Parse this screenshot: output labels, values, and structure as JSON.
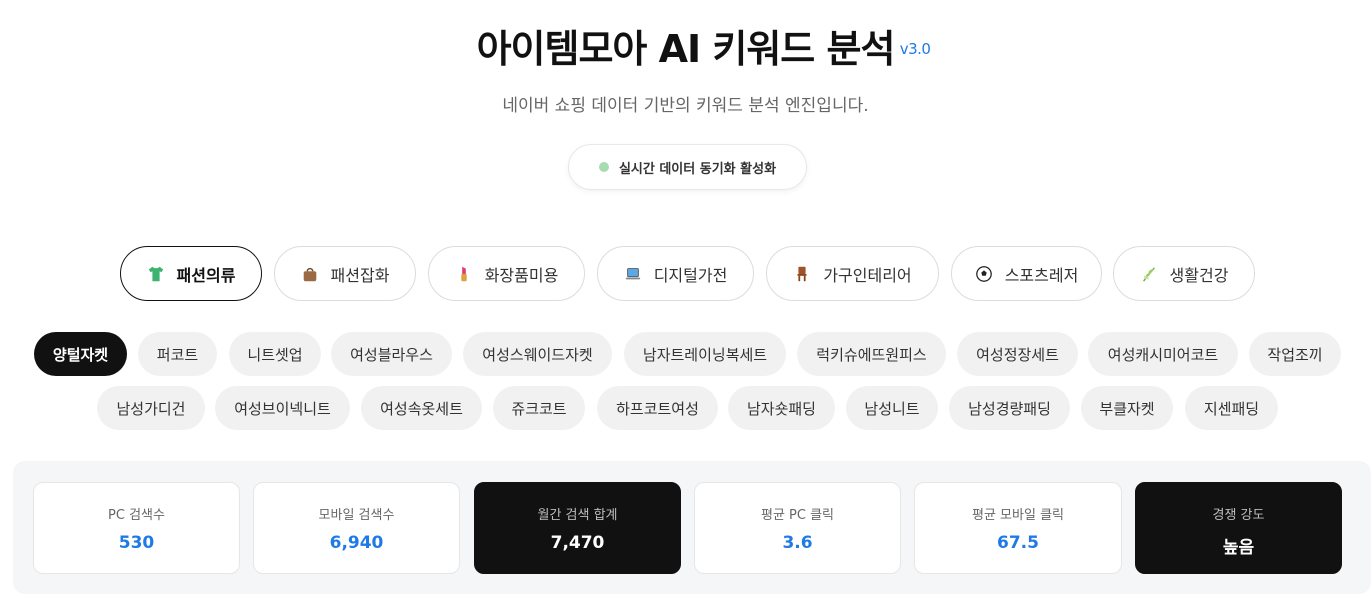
{
  "header": {
    "title": "아이템모아 AI 키워드 분석",
    "version": "v3.0",
    "subtitle": "네이버 쇼핑 데이터 기반의 키워드 분석 엔진입니다.",
    "status": "실시간 데이터 동기화 활성화",
    "status_color": "#a6dcb0"
  },
  "categories": [
    {
      "label": "패션의류",
      "icon": "tshirt-icon",
      "active": true
    },
    {
      "label": "패션잡화",
      "icon": "handbag-icon",
      "active": false
    },
    {
      "label": "화장품미용",
      "icon": "lipstick-icon",
      "active": false
    },
    {
      "label": "디지털가전",
      "icon": "laptop-icon",
      "active": false
    },
    {
      "label": "가구인테리어",
      "icon": "chair-icon",
      "active": false
    },
    {
      "label": "스포츠레저",
      "icon": "soccer-ball-icon",
      "active": false
    },
    {
      "label": "생활건강",
      "icon": "herb-icon",
      "active": false
    }
  ],
  "keywords_row1": [
    "양털자켓",
    "퍼코트",
    "니트셋업",
    "여성블라우스",
    "여성스웨이드자켓",
    "남자트레이닝복세트",
    "럭키슈에뜨원피스",
    "여성정장세트",
    "여성캐시미어코트",
    "작업조끼"
  ],
  "keywords_row2": [
    "남성가디건",
    "여성브이넥니트",
    "여성속옷세트",
    "쥬크코트",
    "하프코트여성",
    "남자숏패딩",
    "남성니트",
    "남성경량패딩",
    "부클자켓",
    "지센패딩"
  ],
  "active_keyword": "양털자켓",
  "stats": [
    {
      "label": "PC 검색수",
      "value": "530",
      "dark": false
    },
    {
      "label": "모바일 검색수",
      "value": "6,940",
      "dark": false
    },
    {
      "label": "월간 검색 합계",
      "value": "7,470",
      "dark": true
    },
    {
      "label": "평균 PC 클릭",
      "value": "3.6",
      "dark": false
    },
    {
      "label": "평균 모바일 클릭",
      "value": "67.5",
      "dark": false
    },
    {
      "label": "경쟁 강도",
      "value": "높음",
      "dark": true
    }
  ],
  "colors": {
    "accent": "#1f7ae6",
    "dark": "#111111",
    "chip_bg": "#f1f1f1"
  }
}
